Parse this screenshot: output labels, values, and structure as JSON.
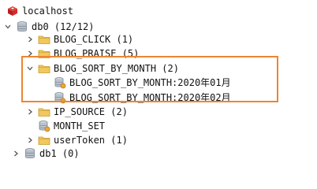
{
  "tree": {
    "server": {
      "label": "localhost",
      "icon": "redis-server-icon"
    },
    "db0": {
      "label": "db0  (12/12)",
      "icon": "database-icon",
      "expanded": true
    },
    "keys": [
      {
        "label": "BLOG_CLICK (1)",
        "icon": "folder-icon",
        "expanded": false
      },
      {
        "label": "BLOG_PRAISE (5)",
        "icon": "folder-icon",
        "expanded": false
      },
      {
        "label": "BLOG_SORT_BY_MONTH (2)",
        "icon": "folder-icon",
        "expanded": true,
        "children": [
          {
            "label": "BLOG_SORT_BY_MONTH:2020年01月",
            "icon": "key-database-icon"
          },
          {
            "label": "BLOG_SORT_BY_MONTH:2020年02月",
            "icon": "key-database-icon"
          }
        ]
      },
      {
        "label": "IP_SOURCE (2)",
        "icon": "folder-icon",
        "expanded": false
      },
      {
        "label": "MONTH_SET",
        "icon": "key-database-icon"
      },
      {
        "label": "userToken (1)",
        "icon": "folder-icon",
        "expanded": false
      }
    ],
    "db1": {
      "label": "db1 (0)",
      "icon": "database-icon",
      "expanded": false
    }
  },
  "colors": {
    "highlight": "#ee8530",
    "folder": "#f2c75c",
    "redis": "#d62b2b",
    "database": "#a9b1bb"
  }
}
